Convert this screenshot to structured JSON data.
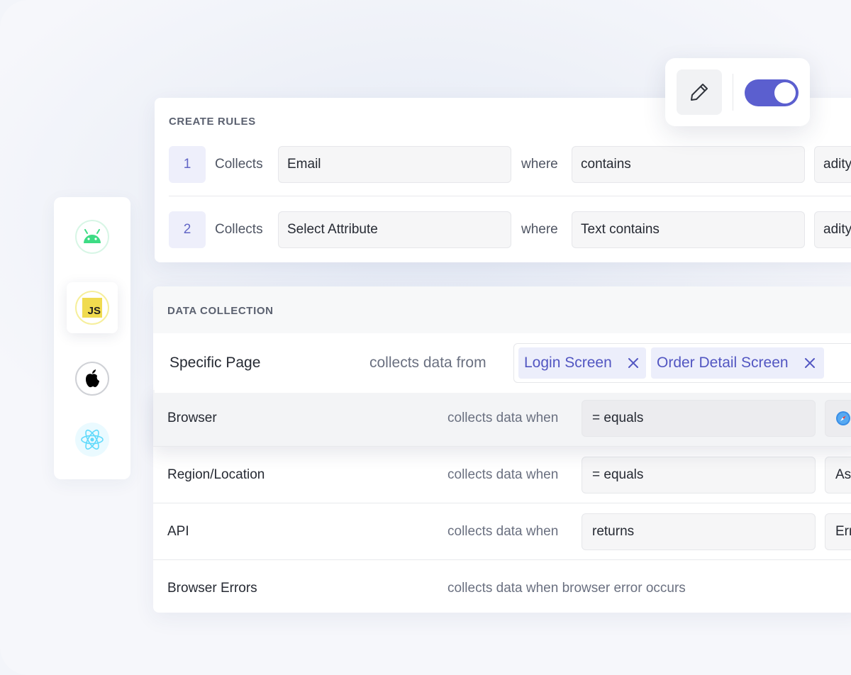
{
  "create_rules": {
    "title": "CREATE RULES",
    "rows": [
      {
        "num": "1",
        "collects": "Collects",
        "attribute": "Email",
        "where": "where",
        "operator": "contains",
        "value": "adity"
      },
      {
        "num": "2",
        "collects": "Collects",
        "attribute": "Select Attribute",
        "where": "where",
        "operator": "Text contains",
        "value": "adity"
      }
    ]
  },
  "toolbar": {
    "edit_icon": "pencil-icon",
    "toggle_on": true,
    "accent": "#5b5fcf"
  },
  "platforms": [
    {
      "icon": "android-icon",
      "color": "#3ddc84"
    },
    {
      "icon": "javascript-icon",
      "label": "JS",
      "color": "#f0db4f"
    },
    {
      "icon": "apple-icon",
      "color": "#000000"
    },
    {
      "icon": "react-icon",
      "color": "#61dafb"
    }
  ],
  "data_collection": {
    "title": "DATA COLLECTION",
    "specific": {
      "label": "Specific Page",
      "middle": "collects data from",
      "chips": [
        "Login Screen",
        "Order Detail Screen"
      ]
    },
    "rows": [
      {
        "label": "Browser",
        "middle": "collects data when",
        "operator": "= equals",
        "value": ""
      },
      {
        "label": "Region/Location",
        "middle": "collects data when",
        "operator": "= equals",
        "value": "As"
      },
      {
        "label": "API",
        "middle": "collects data when",
        "operator": "returns",
        "value": "Err"
      },
      {
        "label": "Browser Errors",
        "middle": "collects data when browser error occurs"
      }
    ]
  }
}
